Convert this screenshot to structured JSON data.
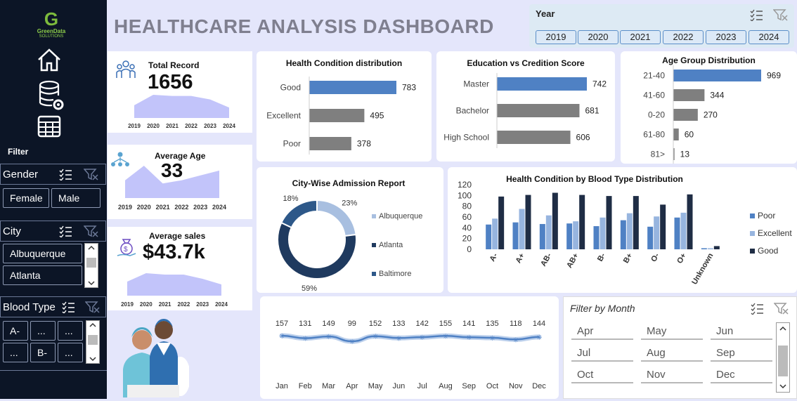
{
  "brand": {
    "logo_letter": "G",
    "name_line1": "GreenData",
    "name_line2": "SOLUTIONS"
  },
  "dashboard": {
    "title": "HEALTHCARE ANALYSIS DASHBOARD"
  },
  "nav": {
    "icons": [
      "home-icon",
      "database-settings-icon",
      "table-icon"
    ]
  },
  "filter_panel": {
    "title": "Filter",
    "gender": {
      "label": "Gender",
      "items": [
        "Female",
        "Male"
      ]
    },
    "city": {
      "label": "City",
      "items": [
        "Albuquerque",
        "Atlanta"
      ]
    },
    "blood_type": {
      "label": "Blood Type",
      "items": [
        "A-",
        "...",
        "...",
        "...",
        "B-",
        "..."
      ]
    }
  },
  "year_slicer": {
    "label": "Year",
    "items": [
      "2019",
      "2020",
      "2021",
      "2022",
      "2023",
      "2024"
    ]
  },
  "kpis": {
    "total_record": {
      "label": "Total Record",
      "value": "1656",
      "years": [
        "2019",
        "2020",
        "2021",
        "2022",
        "2023",
        "2024"
      ]
    },
    "average_age": {
      "label": "Average Age",
      "value": "33",
      "years": [
        "2019",
        "2020",
        "2021",
        "2022",
        "2023",
        "2024"
      ]
    },
    "average_sales": {
      "label": "Average sales",
      "value": "$43.7k",
      "years": [
        "2019",
        "2020",
        "2021",
        "2022",
        "2023",
        "2024"
      ]
    }
  },
  "chart_data": [
    {
      "id": "health",
      "type": "bar",
      "orientation": "horizontal",
      "title": "Health Condition distribution",
      "categories": [
        "Good",
        "Excellent",
        "Poor"
      ],
      "values": [
        783,
        495,
        378
      ],
      "colors": [
        "#4f81c4",
        "#7f7f7f",
        "#7f7f7f"
      ]
    },
    {
      "id": "education",
      "type": "bar",
      "orientation": "horizontal",
      "title": "Education vs Credition Score",
      "categories": [
        "Master",
        "Bachelor",
        "High School"
      ],
      "values": [
        742,
        681,
        606
      ],
      "colors": [
        "#4f81c4",
        "#7f7f7f",
        "#7f7f7f"
      ]
    },
    {
      "id": "age",
      "type": "bar",
      "orientation": "horizontal",
      "title": "Age Group Distribution",
      "categories": [
        "21-40",
        "41-60",
        "0-20",
        "61-80",
        "81>"
      ],
      "values": [
        969,
        344,
        270,
        60,
        13
      ],
      "colors": [
        "#4f81c4",
        "#7f7f7f",
        "#7f7f7f",
        "#7f7f7f",
        "#7f7f7f"
      ]
    },
    {
      "id": "city",
      "type": "pie",
      "variant": "donut",
      "title": "City-Wise Admission Report",
      "categories": [
        "Albuquerque",
        "Atlanta",
        "Baltimore"
      ],
      "values": [
        23,
        59,
        18
      ],
      "labels": [
        "23%",
        "59%",
        "18%"
      ],
      "colors": [
        "#a8bfe0",
        "#1f3a5f",
        "#2d5889"
      ]
    },
    {
      "id": "blood",
      "type": "bar",
      "title": "Health Condition by Blood Type Distribution",
      "categories": [
        "A-",
        "A+",
        "AB-",
        "AB+",
        "B-",
        "B+",
        "O-",
        "O+",
        "Unknown"
      ],
      "ylim": [
        0,
        120
      ],
      "yticks": [
        "0",
        "20",
        "40",
        "60",
        "80",
        "100",
        "120"
      ],
      "series": [
        {
          "name": "Poor",
          "values": [
            46,
            50,
            47,
            48,
            43,
            54,
            42,
            59,
            2
          ],
          "color": "#4f81c4"
        },
        {
          "name": "Excellent",
          "values": [
            57,
            75,
            63,
            52,
            59,
            67,
            61,
            68,
            2
          ],
          "color": "#97b5df"
        },
        {
          "name": "Good",
          "values": [
            98,
            101,
            105,
            101,
            99,
            99,
            83,
            102,
            6
          ],
          "color": "#1f2d45"
        }
      ]
    },
    {
      "id": "monthly",
      "type": "line",
      "title": "",
      "categories": [
        "Jan",
        "Feb",
        "Mar",
        "Apr",
        "May",
        "Jun",
        "Jul",
        "Aug",
        "Sep",
        "Oct",
        "Nov",
        "Dec"
      ],
      "values": [
        157,
        131,
        149,
        99,
        152,
        133,
        142,
        155,
        141,
        135,
        118,
        144
      ],
      "labels": [
        "157",
        "131",
        "149",
        "99",
        "152",
        "133",
        "142",
        "155",
        "141",
        "135",
        "118",
        "144"
      ],
      "color": "#4f81c4"
    },
    {
      "id": "spark_total",
      "type": "area",
      "x": [
        "2019",
        "2020",
        "2021",
        "2022",
        "2023",
        "2024"
      ],
      "values": [
        0.55,
        1.0,
        0.95,
        0.95,
        0.8,
        0.45
      ],
      "color": "#c2c4fa"
    },
    {
      "id": "spark_age",
      "type": "area",
      "x": [
        "2019",
        "2020",
        "2021",
        "2022",
        "2023",
        "2024"
      ],
      "values": [
        0.55,
        1.0,
        0.45,
        0.55,
        0.7,
        0.85
      ],
      "color": "#c2c4fa"
    },
    {
      "id": "spark_sales",
      "type": "area",
      "x": [
        "2019",
        "2020",
        "2021",
        "2022",
        "2023",
        "2024"
      ],
      "values": [
        0.5,
        0.8,
        0.75,
        0.75,
        0.6,
        0.4
      ],
      "color": "#c2c4fa"
    }
  ],
  "month_slicer": {
    "label": "Filter by Month",
    "items": [
      "Apr",
      "May",
      "Jun",
      "Jul",
      "Aug",
      "Sep",
      "Oct",
      "Nov",
      "Dec"
    ]
  }
}
